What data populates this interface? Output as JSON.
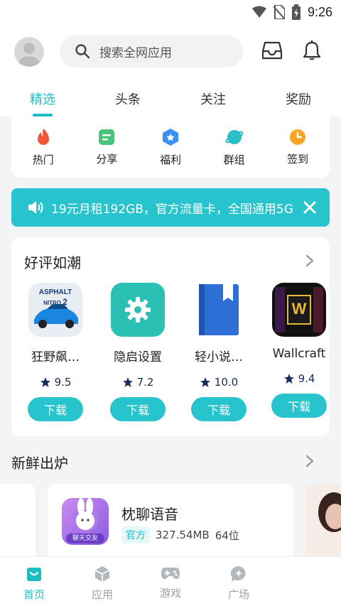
{
  "status_bar": {
    "time": "9:26"
  },
  "header": {
    "search_placeholder": "搜索全网应用",
    "tabs": [
      {
        "label": "精选",
        "active": true
      },
      {
        "label": "头条",
        "active": false
      },
      {
        "label": "关注",
        "active": false
      },
      {
        "label": "奖励",
        "active": false
      }
    ]
  },
  "quick_links": [
    {
      "label": "热门",
      "icon": "fire-icon",
      "color": "#f2563a"
    },
    {
      "label": "分享",
      "icon": "share-doc-icon",
      "color": "#48c27c"
    },
    {
      "label": "福利",
      "icon": "gift-badge-icon",
      "color": "#3b8ff0"
    },
    {
      "label": "群组",
      "icon": "planet-icon",
      "color": "#2bc0c8"
    },
    {
      "label": "签到",
      "icon": "clock-icon",
      "color": "#f6a623"
    }
  ],
  "banner": {
    "text": "19元月租192GB，官方流量卡，全国通用5G"
  },
  "featured": {
    "title": "好评如潮",
    "apps": [
      {
        "name": "狂野飙…",
        "rating": "9.5",
        "button": "下载",
        "icon": "asphalt-nitro-icon"
      },
      {
        "name": "隐启设置",
        "rating": "7.2",
        "button": "下载",
        "icon": "settings-gear-icon"
      },
      {
        "name": "轻小说…",
        "rating": "10.0",
        "button": "下载",
        "icon": "bookmark-book-icon"
      },
      {
        "name": "Wallcraft",
        "rating": "9.4",
        "button": "下载",
        "icon": "wallcraft-icon"
      }
    ],
    "asphalt_logo": "ASPHALT",
    "asphalt_sub": "NITRO",
    "asphalt_num": "2",
    "wallcraft_logo": "W"
  },
  "fresh": {
    "title": "新鲜出炉",
    "app": {
      "name": "枕聊语音",
      "badge": "官方",
      "size": "327.54MB",
      "bits": "64位",
      "icon_text": "聊天交友"
    }
  },
  "bottom_nav": [
    {
      "label": "首页",
      "icon": "home-bag-icon",
      "active": true
    },
    {
      "label": "应用",
      "icon": "cube-icon",
      "active": false
    },
    {
      "label": "游戏",
      "icon": "gamepad-icon",
      "active": false
    },
    {
      "label": "广场",
      "icon": "chat-plus-icon",
      "active": false
    }
  ],
  "colors": {
    "accent": "#27c4cd",
    "accent_text": "#1dbdc4"
  }
}
